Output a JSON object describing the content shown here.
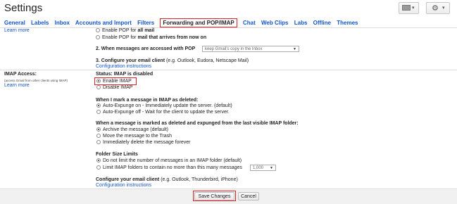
{
  "header": {
    "title": "Settings"
  },
  "tabs": {
    "general": "General",
    "labels": "Labels",
    "inbox": "Inbox",
    "accounts": "Accounts and Import",
    "filters": "Filters",
    "forwarding": "Forwarding and POP/IMAP",
    "chat": "Chat",
    "webclips": "Web Clips",
    "labs": "Labs",
    "offline": "Offline",
    "themes": "Themes"
  },
  "pop": {
    "learn_more": "Learn more",
    "enable_all_prefix": "Enable POP for ",
    "enable_all_bold": "all mail",
    "enable_now_prefix": "Enable POP for ",
    "enable_now_bold": "mail that arrives from now on",
    "q2_label": "2. When messages are accessed with POP",
    "q2_select": "keep Gmail's copy in the Inbox",
    "q3_label": "3. Configure your email client",
    "q3_hint": " (e.g. Outlook, Eudora, Netscape Mail)",
    "config_link": "Configuration instructions"
  },
  "imap": {
    "section_title": "IMAP Access:",
    "section_sub": "(access Gmail from other clients using IMAP)",
    "learn_more": "Learn more",
    "status": "Status: IMAP is disabled",
    "enable": "Enable IMAP",
    "disable": "Disable IMAP",
    "deleted_heading": "When I mark a message in IMAP as deleted:",
    "expunge_on": "Auto-Expunge on - Immediately update the server. (default)",
    "expunge_off": "Auto-Expunge off - Wait for the client to update the server.",
    "expunged_heading": "When a message is marked as deleted and expunged from the last visible IMAP folder:",
    "archive": "Archive the message (default)",
    "trash": "Move the message to the Trash",
    "delete_forever": "Immediately delete the message forever",
    "folder_heading": "Folder Size Limits",
    "no_limit": "Do not limit the number of messages in an IMAP folder (default)",
    "limit": "Limit IMAP folders to contain no more than this many messages",
    "limit_value": "1,000",
    "configure_heading": "Configure your email client",
    "configure_hint": " (e.g. Outlook, Thunderbird, iPhone)",
    "config_link": "Configuration instructions"
  },
  "footer": {
    "save": "Save Changes",
    "cancel": "Cancel"
  },
  "colors": {
    "link": "#1155cc",
    "highlight": "#dd2222"
  }
}
